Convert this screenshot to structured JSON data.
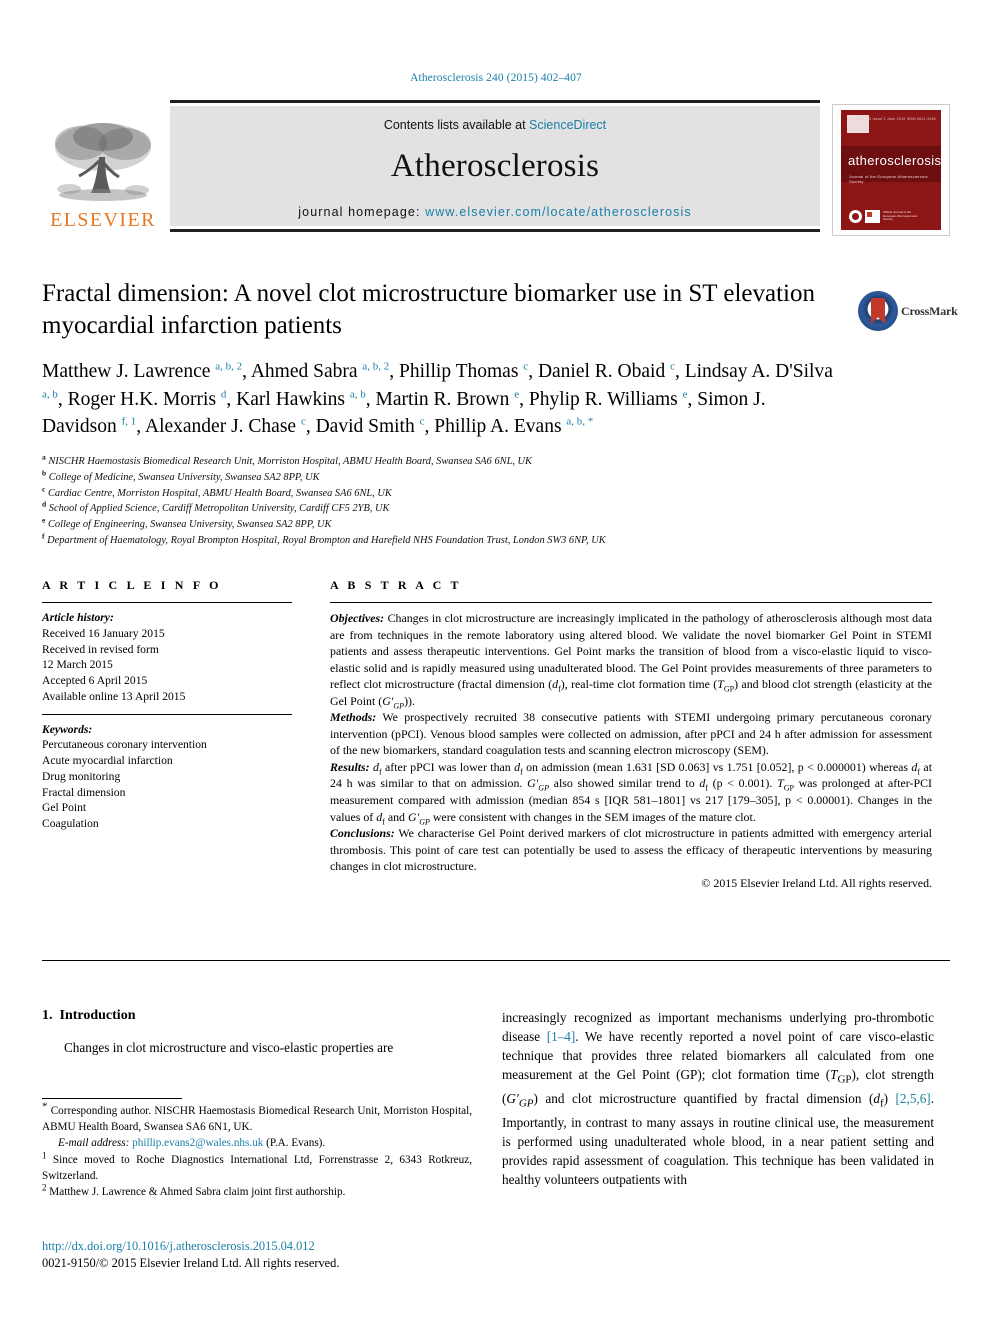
{
  "running_head": "Atherosclerosis 240 (2015) 402–407",
  "masthead": {
    "publisher_logo_text": "ELSEVIER",
    "contents_prefix": "Contents lists available at ",
    "contents_link": "ScienceDirect",
    "journal_title": "Atherosclerosis",
    "homepage_label": "journal homepage:",
    "homepage_url": "www.elsevier.com/locate/atherosclerosis",
    "cover": {
      "name": "atherosclerosis",
      "subtitle": "Journal of the European Atherosclerosis Society",
      "top_right": "Volume 240  Issue 2   June 2015   ISSN 0021-9150",
      "badge_text": "Official Journal of the European Atherosclerosis Society"
    }
  },
  "article": {
    "title": "Fractal dimension: A novel clot microstructure biomarker use in ST elevation myocardial infarction patients",
    "crossmark_label": "CrossMark",
    "authors": [
      {
        "name": "Matthew J. Lawrence",
        "sup": "a, b, 2",
        "sep": ", "
      },
      {
        "name": "Ahmed Sabra",
        "sup": "a, b, 2",
        "sep": ", "
      },
      {
        "name": "Phillip Thomas",
        "sup": "c",
        "sep": ", "
      },
      {
        "name": "Daniel R. Obaid",
        "sup": "c",
        "sep": ", "
      },
      {
        "name": "Lindsay A. D'Silva",
        "sup": "a, b",
        "sep": ", "
      },
      {
        "name": "Roger H.K. Morris",
        "sup": "d",
        "sep": ", "
      },
      {
        "name": "Karl Hawkins",
        "sup": "a, b",
        "sep": ", "
      },
      {
        "name": "Martin R. Brown",
        "sup": "e",
        "sep": ", "
      },
      {
        "name": "Phylip R. Williams",
        "sup": "e",
        "sep": ", "
      },
      {
        "name": "Simon J. Davidson",
        "sup": "f, 1",
        "sep": ", "
      },
      {
        "name": "Alexander J. Chase",
        "sup": "c",
        "sep": ", "
      },
      {
        "name": "David Smith",
        "sup": "c",
        "sep": ", "
      },
      {
        "name": "Phillip A. Evans",
        "sup": "a, b, *",
        "sep": ""
      }
    ],
    "affiliations": [
      {
        "mark": "a",
        "text": "NISCHR Haemostasis Biomedical Research Unit, Morriston Hospital, ABMU Health Board, Swansea SA6 6NL, UK"
      },
      {
        "mark": "b",
        "text": "College of Medicine, Swansea University, Swansea SA2 8PP, UK"
      },
      {
        "mark": "c",
        "text": "Cardiac Centre, Morriston Hospital, ABMU Health Board, Swansea SA6 6NL, UK"
      },
      {
        "mark": "d",
        "text": "School of Applied Science, Cardiff Metropolitan University, Cardiff CF5 2YB, UK"
      },
      {
        "mark": "e",
        "text": "College of Engineering, Swansea University, Swansea SA2 8PP, UK"
      },
      {
        "mark": "f",
        "text": "Department of Haematology, Royal Brompton Hospital, Royal Brompton and Harefield NHS Foundation Trust, London SW3 6NP, UK"
      }
    ]
  },
  "article_info": {
    "heading": "A R T I C L E   I N F O",
    "history_label": "Article history:",
    "history": [
      "Received 16 January 2015",
      "Received in revised form",
      "12 March 2015",
      "Accepted 6 April 2015",
      "Available online 13 April 2015"
    ],
    "keywords_label": "Keywords:",
    "keywords": [
      "Percutaneous coronary intervention",
      "Acute myocardial infarction",
      "Drug monitoring",
      "Fractal dimension",
      "Gel Point",
      "Coagulation"
    ]
  },
  "abstract": {
    "heading": "A B S T R A C T",
    "objectives_label": "Objectives:",
    "objectives_text": " Changes in clot microstructure are increasingly implicated in the pathology of atherosclerosis although most data are from techniques in the remote laboratory using altered blood. We validate the novel biomarker Gel Point in STEMI patients and assess therapeutic interventions. Gel Point marks the transition of blood from a visco-elastic liquid to visco-elastic solid and is rapidly measured using unadulterated blood. The Gel Point provides measurements of three parameters to reflect clot microstructure (fractal dimension (df), real-time clot formation time (TGP) and blood clot strength (elasticity at the Gel Point (G′GP)).",
    "methods_label": "Methods:",
    "methods_text": " We prospectively recruited 38 consecutive patients with STEMI undergoing primary percutaneous coronary intervention (pPCI). Venous blood samples were collected on admission, after pPCI and 24 h after admission for assessment of the new biomarkers, standard coagulation tests and scanning electron microscopy (SEM).",
    "results_label": "Results:",
    "results_text": " df after pPCI was lower than df on admission (mean 1.631 [SD 0.063] vs 1.751 [0.052], p < 0.000001) whereas df at 24 h was similar to that on admission. G′GP also showed similar trend to df (p < 0.001). TGP was prolonged at after-PCI measurement compared with admission (median 854 s [IQR 581–1801] vs 217 [179–305], p < 0.00001). Changes in the values of df and G′GP were consistent with changes in the SEM images of the mature clot.",
    "conclusions_label": "Conclusions:",
    "conclusions_text": " We characterise Gel Point derived markers of clot microstructure in patients admitted with emergency arterial thrombosis. This point of care test can potentially be used to assess the efficacy of therapeutic interventions by measuring changes in clot microstructure.",
    "copyright": "© 2015 Elsevier Ireland Ltd. All rights reserved."
  },
  "body": {
    "section_number": "1.",
    "section_title": "Introduction",
    "left_paragraph": "Changes in clot microstructure and visco-elastic properties are",
    "right_paragraph_1": "increasingly recognized as important mechanisms underlying pro-thrombotic disease ",
    "right_ref_1": "[1–4]",
    "right_paragraph_2": ". We have recently reported a novel point of care visco-elastic technique that provides three related biomarkers all calculated from one measurement at the Gel Point (GP); clot formation time (TGP), clot strength (G′GP) and clot microstructure quantified by fractal dimension (df) ",
    "right_ref_2": "[2,5,6]",
    "right_paragraph_3": ". Importantly, in contrast to many assays in routine clinical use, the measurement is performed using unadulterated whole blood, in a near patient setting and provides rapid assessment of coagulation. This technique has been validated in healthy volunteers outpatients with"
  },
  "footnotes": {
    "corresponding": "Corresponding author. NISCHR Haemostasis Biomedical Research Unit, Morriston Hospital, ABMU Health Board, Swansea SA6 6N1, UK.",
    "email_label": "E-mail address:",
    "email": "phillip.evans2@wales.nhs.uk",
    "email_suffix": " (P.A. Evans).",
    "note1_mark": "1",
    "note1": " Since moved to Roche Diagnostics International Ltd, Forrenstrasse 2, 6343 Rotkreuz, Switzerland.",
    "note2_mark": "2",
    "note2": " Matthew J. Lawrence & Ahmed Sabra claim joint first authorship."
  },
  "doi_block": {
    "doi": "http://dx.doi.org/10.1016/j.atherosclerosis.2015.04.012",
    "issn": "0021-9150/© 2015 Elsevier Ireland Ltd. All rights reserved."
  },
  "colors": {
    "link": "#1a7fa8",
    "elsevier_orange": "#e87722",
    "cover_red": "#8c1515",
    "panel_gray": "#e2e2e2"
  }
}
